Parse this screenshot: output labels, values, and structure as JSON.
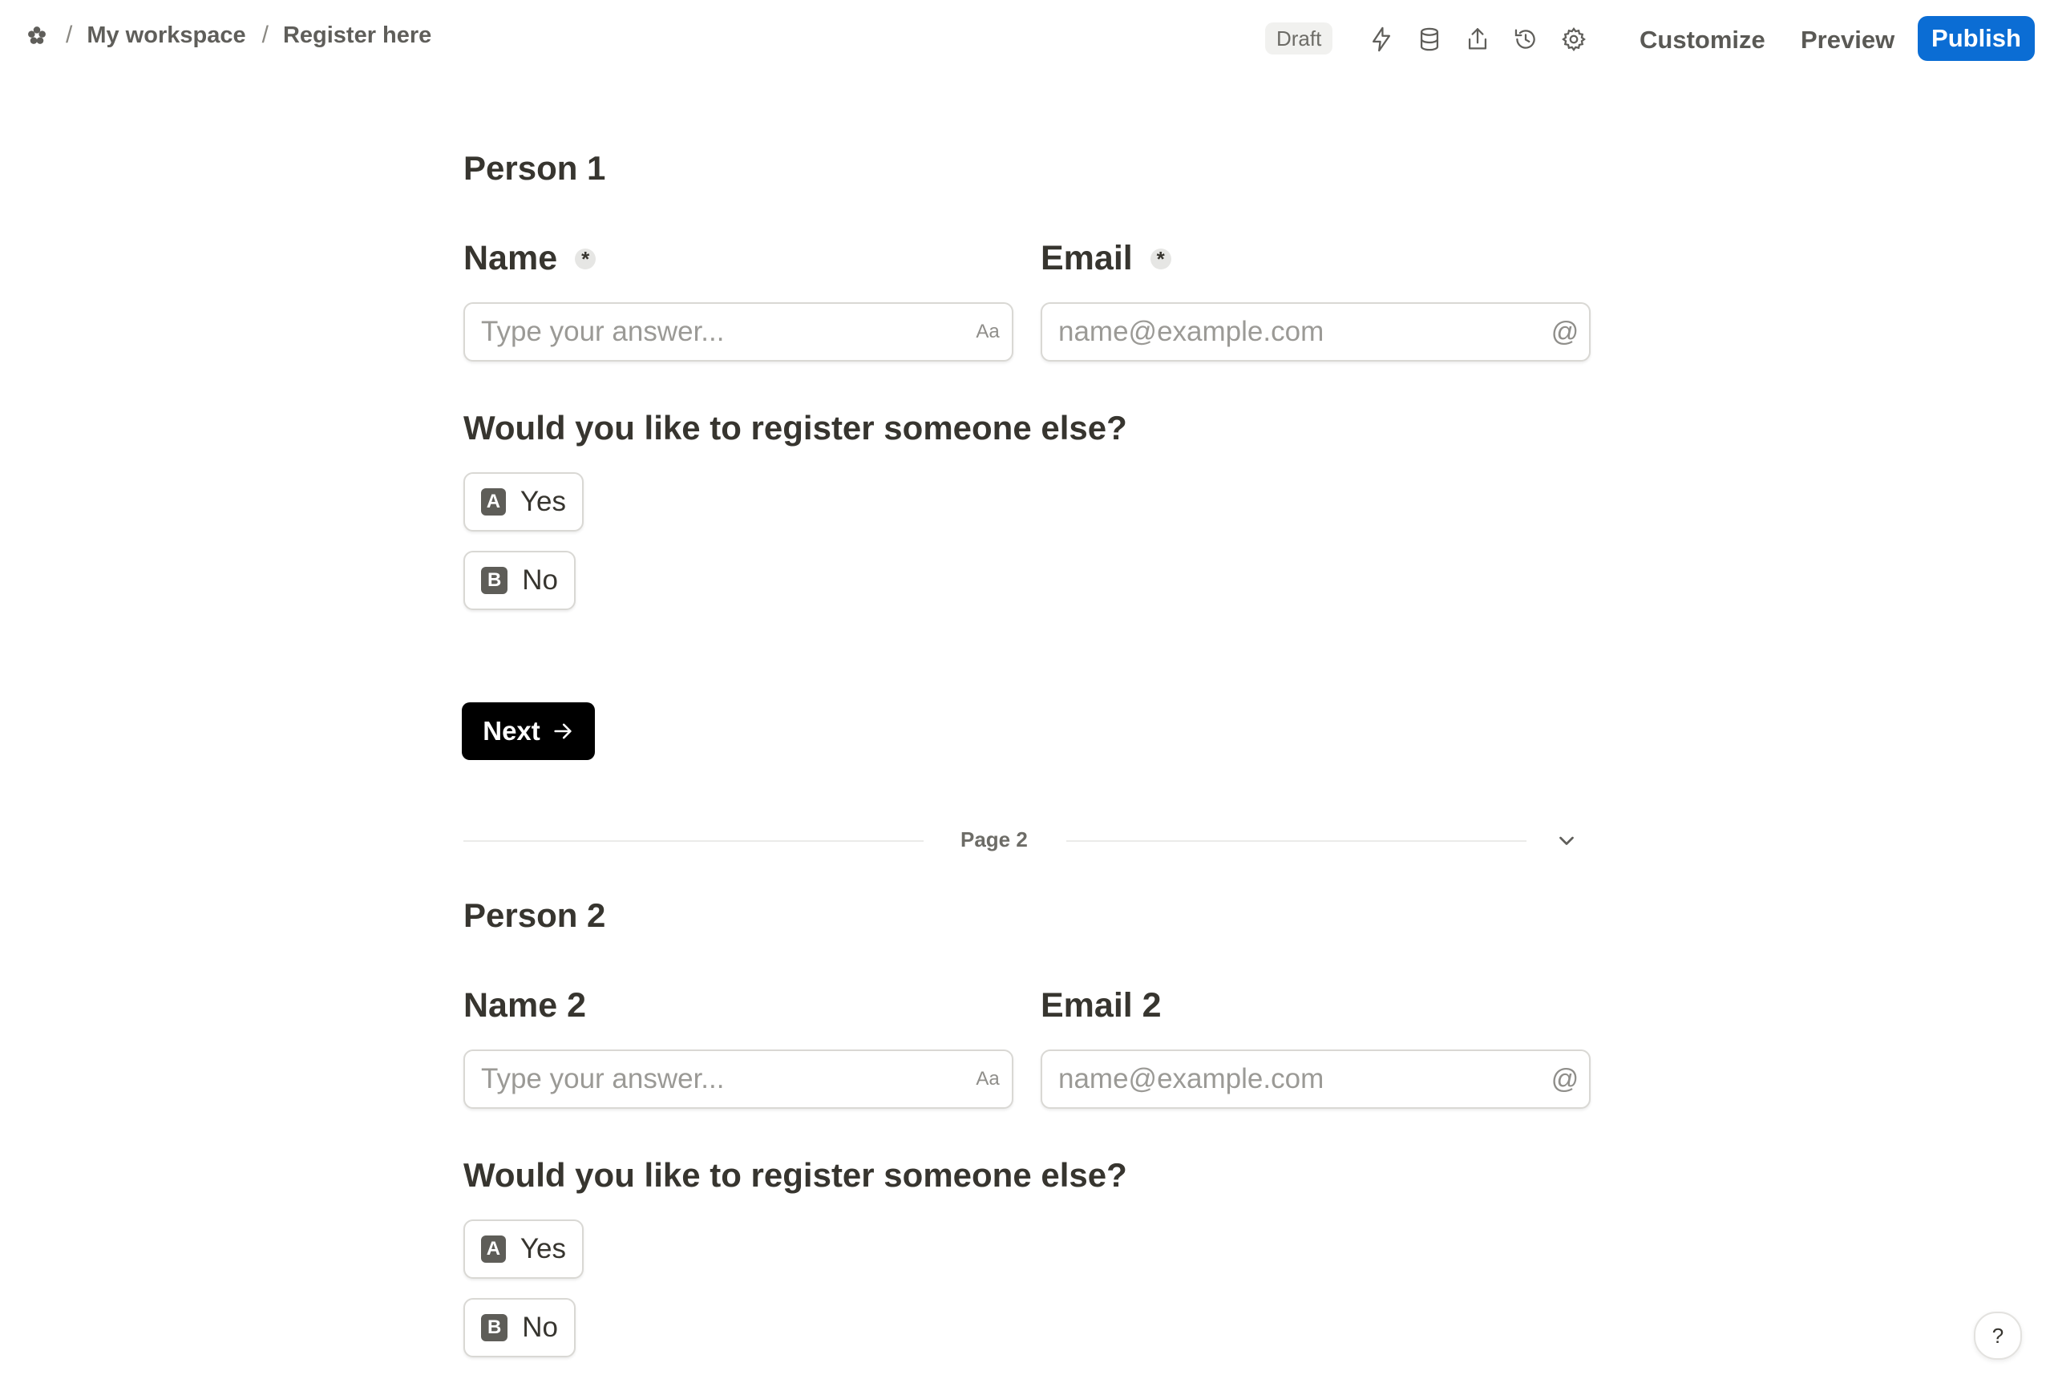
{
  "breadcrumb": {
    "workspace": "My workspace",
    "page": "Register here",
    "separator": "/"
  },
  "toolbar": {
    "status": "Draft",
    "customize_label": "Customize",
    "preview_label": "Preview",
    "publish_label": "Publish",
    "icons": [
      "lightning-icon",
      "database-icon",
      "share-icon",
      "history-icon",
      "settings-icon"
    ]
  },
  "page1": {
    "title": "Person 1",
    "name_label": "Name",
    "email_label": "Email",
    "required_mark": "*",
    "name_placeholder": "Type your answer...",
    "email_placeholder": "name@example.com",
    "text_suffix": "Aa",
    "email_suffix": "@",
    "question": "Would you like to register someone else?",
    "choices": [
      {
        "key": "A",
        "label": "Yes"
      },
      {
        "key": "B",
        "label": "No"
      }
    ],
    "next_label": "Next"
  },
  "page_divider": {
    "label": "Page 2"
  },
  "page2": {
    "title": "Person 2",
    "name_label": "Name 2",
    "email_label": "Email 2",
    "name_placeholder": "Type your answer...",
    "email_placeholder": "name@example.com",
    "text_suffix": "Aa",
    "email_suffix": "@",
    "question": "Would you like to register someone else?",
    "choices": [
      {
        "key": "A",
        "label": "Yes"
      },
      {
        "key": "B",
        "label": "No"
      }
    ]
  },
  "help": {
    "label": "?"
  },
  "colors": {
    "accent": "#0b6dd4",
    "next_button": "#000000",
    "text": "#37352f"
  }
}
